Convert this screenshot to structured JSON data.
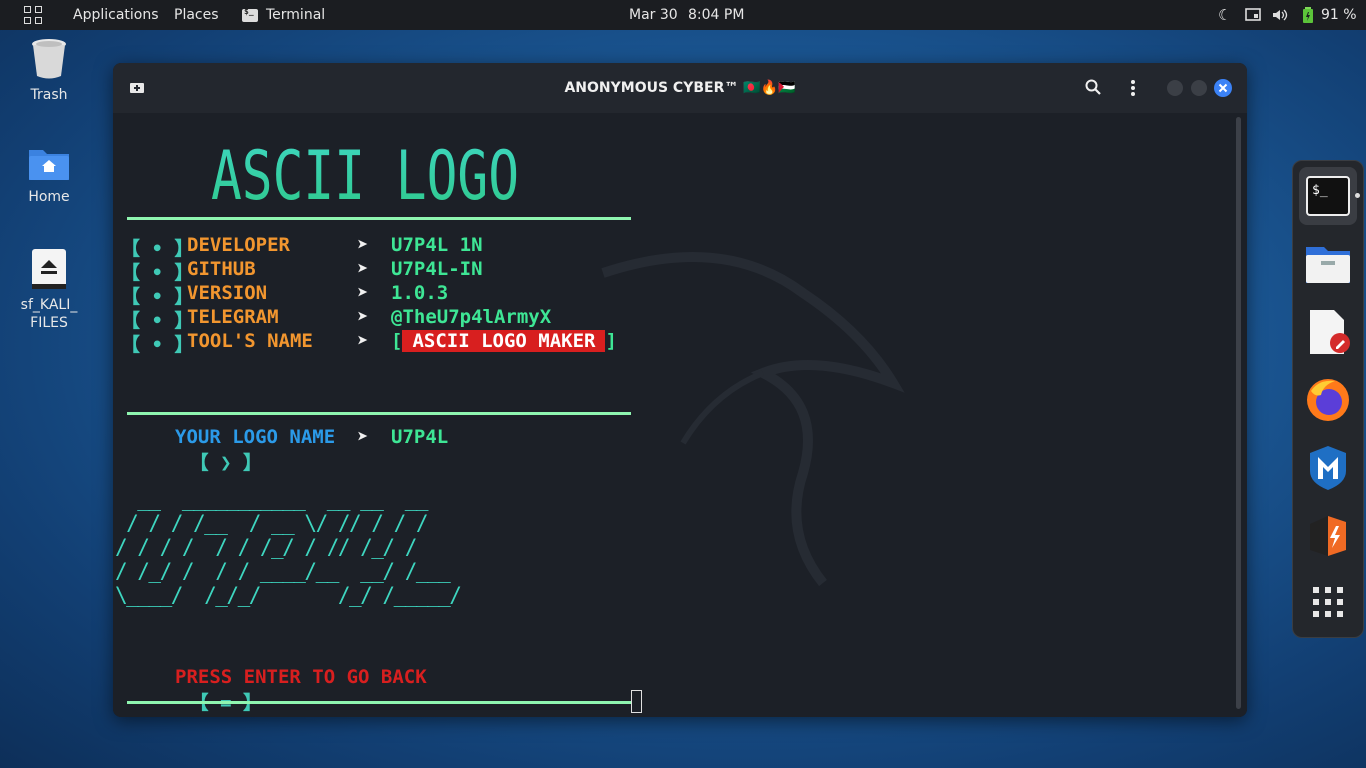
{
  "topbar": {
    "applications": "Applications",
    "places": "Places",
    "terminal": "Terminal",
    "date": "Mar 30",
    "time": "8:04 PM",
    "battery": "91 %"
  },
  "desktop": {
    "trash": "Trash",
    "home": "Home",
    "drive_line1": "sf_KALI_",
    "drive_line2": "FILES"
  },
  "window": {
    "title": "ANONYMOUS CYBER™ 🇧🇩🔥🇵🇸"
  },
  "terminal": {
    "ascii_title": "ASCII LOGO",
    "bullet": "【 • 】",
    "arrow": "➤",
    "info": [
      {
        "key": "DEVELOPER",
        "value": "U7P4L 1N"
      },
      {
        "key": "GITHUB",
        "value": "U7P4L-IN"
      },
      {
        "key": "VERSION",
        "value": "1.0.3"
      },
      {
        "key": "TELEGRAM",
        "value": "@TheU7p4lArmyX"
      },
      {
        "key": "TOOL'S NAME",
        "value": "ASCII LOGO MAKER"
      }
    ],
    "prompt_bracket": "【 ❯ 】",
    "prompt_label": "YOUR LOGO NAME",
    "prompt_value": "U7P4L",
    "ascii_art": [
      "  __  ___________  __ __  __",
      " / / / /__  / __ \\/ // / / /",
      "/ / / /  / / /_/ / // /_/ /",
      "/ /_/ /  / / ____/__  __/ /___",
      "\\____/  /_/_/       /_/ /_____/"
    ],
    "back_bracket": "【 = 】",
    "back_text": "PRESS ENTER TO GO BACK"
  },
  "colors": {
    "accent_green": "#8ff5b0",
    "orange": "#f2962f",
    "red": "#d81f1f",
    "blue": "#2b9ae8"
  }
}
